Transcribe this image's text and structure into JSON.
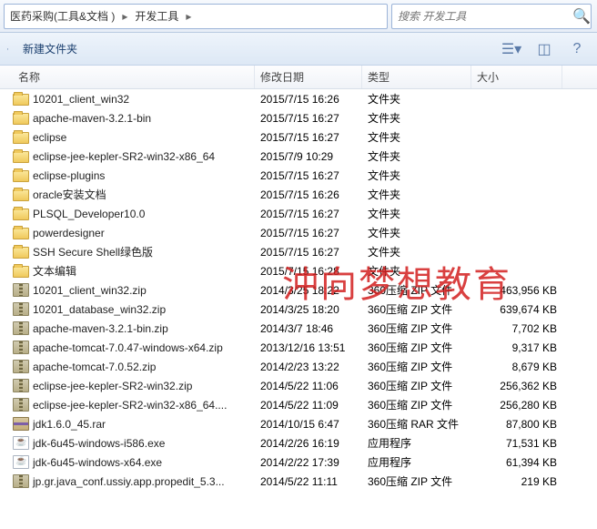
{
  "breadcrumb": {
    "items": [
      "医药采购(工具&文档 )",
      "开发工具"
    ]
  },
  "search": {
    "placeholder": "搜索 开发工具"
  },
  "toolbar": {
    "new_folder": "新建文件夹"
  },
  "columns": {
    "name": "名称",
    "date": "修改日期",
    "type": "类型",
    "size": "大小"
  },
  "rows": [
    {
      "icon": "folder",
      "name": "10201_client_win32",
      "date": "2015/7/15 16:26",
      "type": "文件夹",
      "size": ""
    },
    {
      "icon": "folder",
      "name": "apache-maven-3.2.1-bin",
      "date": "2015/7/15 16:27",
      "type": "文件夹",
      "size": ""
    },
    {
      "icon": "folder",
      "name": "eclipse",
      "date": "2015/7/15 16:27",
      "type": "文件夹",
      "size": ""
    },
    {
      "icon": "folder",
      "name": "eclipse-jee-kepler-SR2-win32-x86_64",
      "date": "2015/7/9 10:29",
      "type": "文件夹",
      "size": ""
    },
    {
      "icon": "folder",
      "name": "eclipse-plugins",
      "date": "2015/7/15 16:27",
      "type": "文件夹",
      "size": ""
    },
    {
      "icon": "folder",
      "name": "oracle安装文档",
      "date": "2015/7/15 16:26",
      "type": "文件夹",
      "size": ""
    },
    {
      "icon": "folder",
      "name": "PLSQL_Developer10.0",
      "date": "2015/7/15 16:27",
      "type": "文件夹",
      "size": ""
    },
    {
      "icon": "folder",
      "name": "powerdesigner",
      "date": "2015/7/15 16:27",
      "type": "文件夹",
      "size": ""
    },
    {
      "icon": "folder",
      "name": "SSH Secure Shell绿色版",
      "date": "2015/7/15 16:27",
      "type": "文件夹",
      "size": ""
    },
    {
      "icon": "folder",
      "name": "文本编辑",
      "date": "2015/7/15 16:28",
      "type": "文件夹",
      "size": ""
    },
    {
      "icon": "zip",
      "name": "10201_client_win32.zip",
      "date": "2014/3/25 18:22",
      "type": "360压缩 ZIP 文件",
      "size": "463,956 KB"
    },
    {
      "icon": "zip",
      "name": "10201_database_win32.zip",
      "date": "2014/3/25 18:20",
      "type": "360压缩 ZIP 文件",
      "size": "639,674 KB"
    },
    {
      "icon": "zip",
      "name": "apache-maven-3.2.1-bin.zip",
      "date": "2014/3/7 18:46",
      "type": "360压缩 ZIP 文件",
      "size": "7,702 KB"
    },
    {
      "icon": "zip",
      "name": "apache-tomcat-7.0.47-windows-x64.zip",
      "date": "2013/12/16 13:51",
      "type": "360压缩 ZIP 文件",
      "size": "9,317 KB"
    },
    {
      "icon": "zip",
      "name": "apache-tomcat-7.0.52.zip",
      "date": "2014/2/23 13:22",
      "type": "360压缩 ZIP 文件",
      "size": "8,679 KB"
    },
    {
      "icon": "zip",
      "name": "eclipse-jee-kepler-SR2-win32.zip",
      "date": "2014/5/22 11:06",
      "type": "360压缩 ZIP 文件",
      "size": "256,362 KB"
    },
    {
      "icon": "zip",
      "name": "eclipse-jee-kepler-SR2-win32-x86_64....",
      "date": "2014/5/22 11:09",
      "type": "360压缩 ZIP 文件",
      "size": "256,280 KB"
    },
    {
      "icon": "rar",
      "name": "jdk1.6.0_45.rar",
      "date": "2014/10/15 6:47",
      "type": "360压缩 RAR 文件",
      "size": "87,800 KB"
    },
    {
      "icon": "exe",
      "name": "jdk-6u45-windows-i586.exe",
      "date": "2014/2/26 16:19",
      "type": "应用程序",
      "size": "71,531 KB"
    },
    {
      "icon": "exe",
      "name": "jdk-6u45-windows-x64.exe",
      "date": "2014/2/22 17:39",
      "type": "应用程序",
      "size": "61,394 KB"
    },
    {
      "icon": "zip",
      "name": "jp.gr.java_conf.ussiy.app.propedit_5.3...",
      "date": "2014/5/22 11:11",
      "type": "360压缩 ZIP 文件",
      "size": "219 KB"
    }
  ],
  "watermark": "沖向梦想教育"
}
